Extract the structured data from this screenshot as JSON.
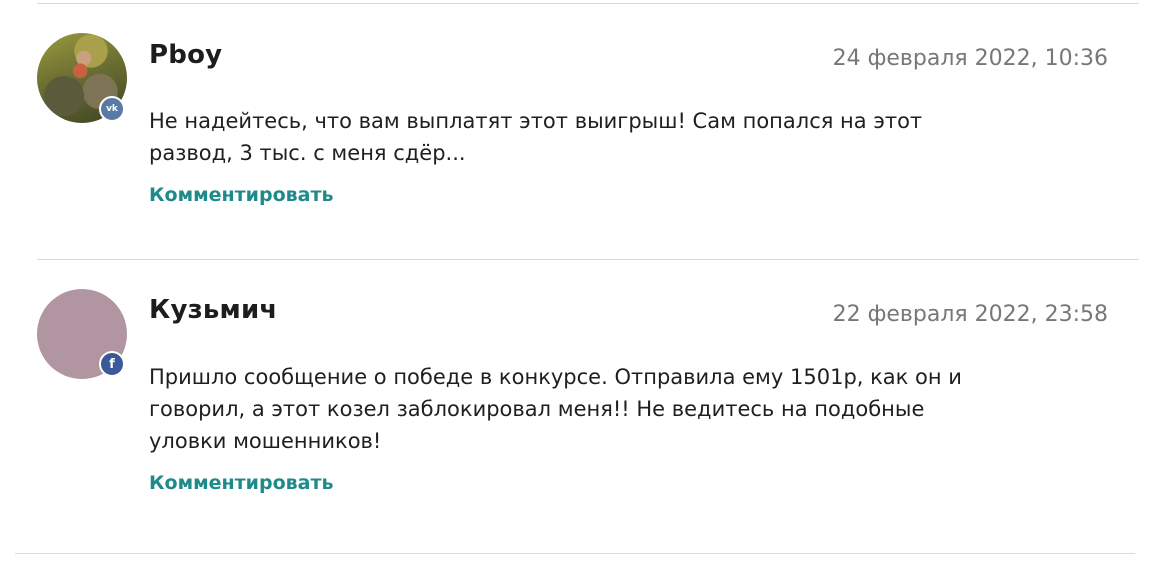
{
  "comments": [
    {
      "author": "Pboy",
      "date": "24 февраля 2022, 10:36",
      "text_lines": [
        "Не надейтесь, что вам выплатят этот выигрыш! Сам попался на этот",
        "развод, 3 тыс. с меня сдёр..."
      ],
      "reply_label": "Комментировать",
      "social": "vk",
      "social_label": "vk",
      "avatar": "photo"
    },
    {
      "author": "Кузьмич",
      "date": "22 февраля 2022, 23:58",
      "text_lines": [
        "Пришло сообщение о победе в конкурсе. Отправила ему 1501р, как он и",
        "говорил, а этот козел заблокировал меня!! Не ведитесь на подобные",
        "уловки мошенников!"
      ],
      "reply_label": "Комментировать",
      "social": "facebook",
      "social_label": "f",
      "avatar": "plain"
    }
  ],
  "colors": {
    "accent": "#1f8a8a",
    "date": "#777777",
    "divider": "#dadada",
    "vk_badge": "#5a7aa6",
    "facebook_badge": "#3b5998",
    "plain_avatar": "#b196a2"
  },
  "icons": {
    "vk": "vk-icon",
    "facebook": "facebook-icon"
  }
}
